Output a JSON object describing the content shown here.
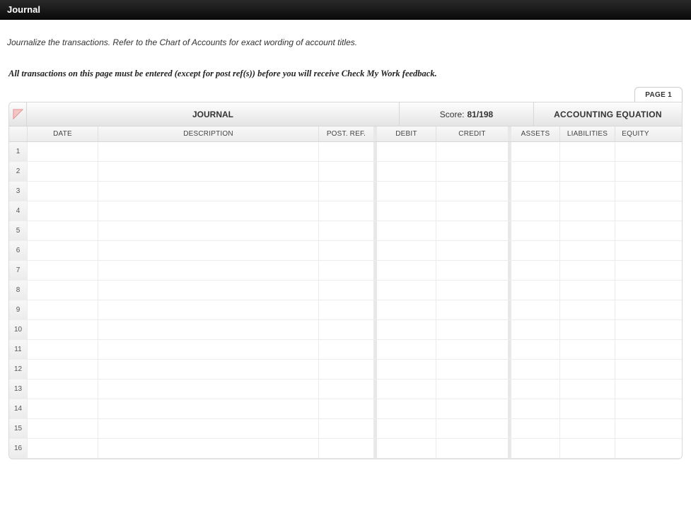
{
  "topbar": {
    "title": "Journal"
  },
  "instructions": {
    "line1": "Journalize the transactions. Refer to the Chart of Accounts for exact wording of account titles.",
    "line2": "All transactions on this page must be entered (except for post ref(s)) before you will receive Check My Work feedback."
  },
  "page_tab": "PAGE 1",
  "journal": {
    "title": "JOURNAL",
    "score_label": "Score:",
    "score_value": "81/198",
    "equation_title": "ACCOUNTING EQUATION",
    "columns": {
      "date": "DATE",
      "description": "DESCRIPTION",
      "post_ref": "POST. REF.",
      "debit": "DEBIT",
      "credit": "CREDIT",
      "assets": "ASSETS",
      "liabilities": "LIABILITIES",
      "equity": "EQUITY"
    },
    "rows": [
      {
        "n": "1",
        "date": "",
        "description": "",
        "post_ref": "",
        "debit": "",
        "credit": "",
        "assets": "",
        "liabilities": "",
        "equity": ""
      },
      {
        "n": "2",
        "date": "",
        "description": "",
        "post_ref": "",
        "debit": "",
        "credit": "",
        "assets": "",
        "liabilities": "",
        "equity": ""
      },
      {
        "n": "3",
        "date": "",
        "description": "",
        "post_ref": "",
        "debit": "",
        "credit": "",
        "assets": "",
        "liabilities": "",
        "equity": ""
      },
      {
        "n": "4",
        "date": "",
        "description": "",
        "post_ref": "",
        "debit": "",
        "credit": "",
        "assets": "",
        "liabilities": "",
        "equity": ""
      },
      {
        "n": "5",
        "date": "",
        "description": "",
        "post_ref": "",
        "debit": "",
        "credit": "",
        "assets": "",
        "liabilities": "",
        "equity": ""
      },
      {
        "n": "6",
        "date": "",
        "description": "",
        "post_ref": "",
        "debit": "",
        "credit": "",
        "assets": "",
        "liabilities": "",
        "equity": ""
      },
      {
        "n": "7",
        "date": "",
        "description": "",
        "post_ref": "",
        "debit": "",
        "credit": "",
        "assets": "",
        "liabilities": "",
        "equity": ""
      },
      {
        "n": "8",
        "date": "",
        "description": "",
        "post_ref": "",
        "debit": "",
        "credit": "",
        "assets": "",
        "liabilities": "",
        "equity": ""
      },
      {
        "n": "9",
        "date": "",
        "description": "",
        "post_ref": "",
        "debit": "",
        "credit": "",
        "assets": "",
        "liabilities": "",
        "equity": ""
      },
      {
        "n": "10",
        "date": "",
        "description": "",
        "post_ref": "",
        "debit": "",
        "credit": "",
        "assets": "",
        "liabilities": "",
        "equity": ""
      },
      {
        "n": "11",
        "date": "",
        "description": "",
        "post_ref": "",
        "debit": "",
        "credit": "",
        "assets": "",
        "liabilities": "",
        "equity": ""
      },
      {
        "n": "12",
        "date": "",
        "description": "",
        "post_ref": "",
        "debit": "",
        "credit": "",
        "assets": "",
        "liabilities": "",
        "equity": ""
      },
      {
        "n": "13",
        "date": "",
        "description": "",
        "post_ref": "",
        "debit": "",
        "credit": "",
        "assets": "",
        "liabilities": "",
        "equity": ""
      },
      {
        "n": "14",
        "date": "",
        "description": "",
        "post_ref": "",
        "debit": "",
        "credit": "",
        "assets": "",
        "liabilities": "",
        "equity": ""
      },
      {
        "n": "15",
        "date": "",
        "description": "",
        "post_ref": "",
        "debit": "",
        "credit": "",
        "assets": "",
        "liabilities": "",
        "equity": ""
      },
      {
        "n": "16",
        "date": "",
        "description": "",
        "post_ref": "",
        "debit": "",
        "credit": "",
        "assets": "",
        "liabilities": "",
        "equity": ""
      }
    ]
  }
}
